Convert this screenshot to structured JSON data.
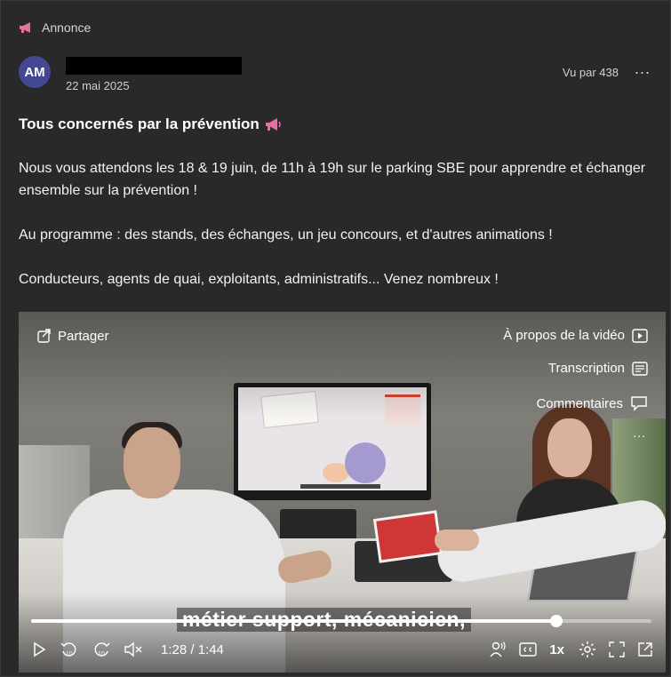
{
  "header": {
    "announce_label": "Annonce",
    "avatar_initials": "AM",
    "date": "22 mai 2025",
    "views": "Vu par 438",
    "more": "..."
  },
  "post": {
    "title": "Tous concernés par la prévention",
    "paragraphs": [
      "Nous vous attendons les 18 & 19 juin, de 11h à 19h sur le parking SBE pour apprendre et échanger ensemble sur la prévention !",
      "Au programme : des stands, des échanges, un jeu concours, et d'autres animations !",
      "Conducteurs, agents de quai, exploitants, administratifs... Venez nombreux !"
    ]
  },
  "video": {
    "share_label": "Partager",
    "about_label": "À propos de la vidéo",
    "transcript_label": "Transcription",
    "comments_label": "Commentaires",
    "more": "...",
    "caption": "métier support, mécanicien,",
    "time": "1:28 / 1:44",
    "progress_fraction": 0.846,
    "rate": "1x",
    "skip_back_seconds": "10",
    "skip_forward_seconds": "10"
  },
  "colors": {
    "background": "#292929",
    "avatar": "#444791",
    "accent_announce": "#e86fa1"
  },
  "icons": [
    "megaphone-icon",
    "share-icon",
    "play-icon",
    "transcript-icon",
    "comment-icon",
    "replay-10-icon",
    "forward-10-icon",
    "volume-mute-icon",
    "audio-description-icon",
    "closed-captions-icon",
    "settings-icon",
    "fullscreen-icon",
    "popout-icon"
  ]
}
